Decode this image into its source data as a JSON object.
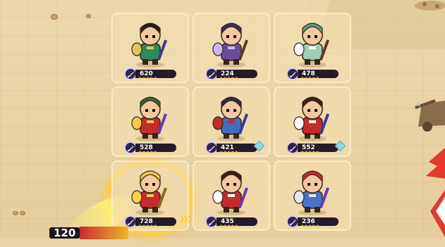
{
  "bottom_hud": {
    "level": "120"
  },
  "heroes": [
    {
      "power": "620",
      "stars": "★★★★★",
      "weapon_icon": "sword-icon",
      "armor": "#2e8b57",
      "hair": "#2a1a10",
      "accent": "#e3c45c",
      "weapon_color": "#3b3c8c",
      "extra": "none"
    },
    {
      "power": "224",
      "stars": "★★★★★",
      "weapon_icon": "sword-icon",
      "armor": "#6b4c99",
      "hair": "#3a2e5a",
      "accent": "#c9b6f0",
      "weapon_color": "#5b3a22",
      "extra": "none"
    },
    {
      "power": "478",
      "stars": "★★★★★",
      "weapon_icon": "sword-icon",
      "armor": "#9bd1b4",
      "hair": "#5aa07a",
      "accent": "#ffffff",
      "weapon_color": "#5b3a22",
      "extra": "none"
    },
    {
      "power": "528",
      "stars": "★★★★★",
      "weapon_icon": "sword-icon",
      "armor": "#c62b2b",
      "hair": "#2e6b3a",
      "accent": "#f2c94c",
      "weapon_color": "#6a3bb0",
      "extra": "none"
    },
    {
      "power": "421",
      "stars": "★★★★★",
      "weapon_icon": "sword-icon",
      "armor": "#3f6fc2",
      "hair": "#2a2a44",
      "accent": "#c62b2b",
      "weapon_color": "#3b3c8c",
      "extra": "gem"
    },
    {
      "power": "552",
      "stars": "★★★★★",
      "weapon_icon": "sword-icon",
      "armor": "#c62b2b",
      "hair": "#3a2014",
      "accent": "#ffffff",
      "weapon_color": "#3b3c8c",
      "extra": "gem"
    },
    {
      "power": "728",
      "stars": "★★★★★",
      "weapon_icon": "sword-icon",
      "armor": "#c62b2b",
      "hair": "#f2c94c",
      "accent": "#f7d24a",
      "weapon_color": "#8a6a1a",
      "extra": "chevron"
    },
    {
      "power": "435",
      "stars": "★★★★★",
      "weapon_icon": "sword-icon",
      "armor": "#c62b2b",
      "hair": "#3a2014",
      "accent": "#ffffff",
      "weapon_color": "#6a3bb0",
      "extra": "none"
    },
    {
      "power": "236",
      "stars": "★★★★★",
      "weapon_icon": "sword-icon",
      "armor": "#4a72c8",
      "hair": "#c62b2b",
      "accent": "#e0e6f0",
      "weapon_color": "#6a3bb0",
      "extra": "none"
    }
  ],
  "colors": {
    "gold": "#f5c431",
    "badge_bg": "#231a2b",
    "tile": "#f5e2b4"
  }
}
